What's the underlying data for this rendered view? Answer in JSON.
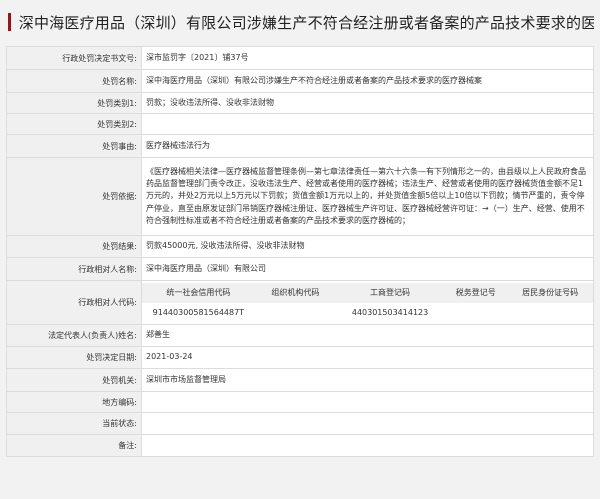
{
  "title": "深中海医疗用品（深圳）有限公司涉嫌生产不符合经注册或者备案的产品技术要求的医疗器...",
  "fields": {
    "doc_no": {
      "label": "行政处罚决定书文号:",
      "value": "深市监罚字〔2021〕铺37号"
    },
    "name": {
      "label": "处罚名称:",
      "value": "深中海医疗用品（深圳）有限公司涉嫌生产不符合经注册或者备案的产品技术要求的医疗器械案"
    },
    "cat1": {
      "label": "处罚类别1:",
      "value": "罚款；没收违法所得、没收非法财物"
    },
    "cat2": {
      "label": "处罚类别2:",
      "value": ""
    },
    "cause": {
      "label": "处罚事由:",
      "value": "医疗器械违法行为"
    },
    "basis": {
      "label": "处罚依据:",
      "value": "《医疗器械相关法律—医疗器械监督管理条例—第七章法律责任—第六十六条—有下列情形之一的，由县级以上人民政府食品药品监督管理部门责令改正，没收违法生产、经营或者使用的医疗器械；违法生产、经营或者使用的医疗器械货值金额不足1万元的，并处2万元以上5万元以下罚款；货值金额1万元以上的，并处货值金额5倍以上10倍以下罚款；情节严重的，责令停产停业，直至由原发证部门吊销医疗器械注册证、医疗器械生产许可证、医疗器械经营许可证：→（一）生产、经营、使用不符合强制性标准或者不符合经注册或者备案的产品技术要求的医疗器械的；"
    },
    "result": {
      "label": "处罚结果:",
      "value": "罚款45000元, 没收违法所得、没收非法财物"
    },
    "counterpart": {
      "label": "行政相对人名称:",
      "value": "深中海医疗用品（深圳）有限公司"
    },
    "codes": {
      "label": "行政相对人代码:",
      "headers": [
        "统一社会信用代码",
        "组织机构代码",
        "工商登记码",
        "税务登记号",
        "居民身份证号码"
      ],
      "values": [
        "91440300581564487T",
        "",
        "440301503414123",
        "",
        ""
      ]
    },
    "legal_rep": {
      "label": "法定代表人(负责人)姓名:",
      "value": "郑善生"
    },
    "date": {
      "label": "处罚决定日期:",
      "value": "2021-03-24"
    },
    "authority": {
      "label": "处罚机关:",
      "value": "深圳市市场监督管理局"
    },
    "region": {
      "label": "地方编码:",
      "value": ""
    },
    "status": {
      "label": "当前状态:",
      "value": ""
    },
    "remark": {
      "label": "备注:",
      "value": ""
    }
  }
}
